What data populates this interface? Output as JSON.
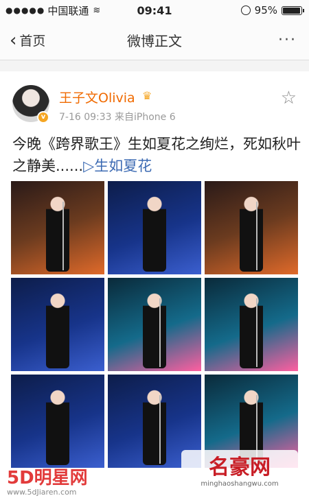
{
  "status_bar": {
    "signal_dots": "●●●●●",
    "carrier": "中国联通",
    "wifi_icon": "wifi-icon",
    "time": "09:41",
    "battery_percent_text": "95%",
    "battery_level": 0.95
  },
  "navbar": {
    "back_label": "首页",
    "title": "微博正文",
    "more_label": "···"
  },
  "post": {
    "author": "王子文Olivia",
    "verified_icon": "verified-badge-icon",
    "meta": "7-16 09:33  来自iPhone 6",
    "text_prefix": "今晚《跨界歌王》生如夏花之绚烂，死如秋叶之静美......",
    "link_label": "▷生如夏花",
    "photos": [
      {
        "alt": "photo-1"
      },
      {
        "alt": "photo-2"
      },
      {
        "alt": "photo-3"
      },
      {
        "alt": "photo-4"
      },
      {
        "alt": "photo-5"
      },
      {
        "alt": "photo-6"
      },
      {
        "alt": "photo-7"
      },
      {
        "alt": "photo-8"
      },
      {
        "alt": "photo-9"
      }
    ]
  },
  "watermarks": {
    "left_logo": "5D明星网",
    "left_url": "www.5dJiaren.com",
    "right_logo": "名豪网",
    "right_url": "minghaoshangwu.com"
  },
  "colors": {
    "username": "#f06a00",
    "link": "#3d6bb3",
    "badge": "#f5a623"
  }
}
